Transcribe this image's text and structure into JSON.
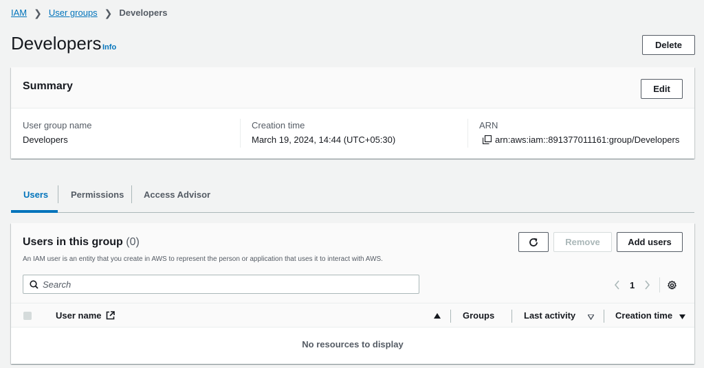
{
  "breadcrumb": {
    "root": "IAM",
    "parent": "User groups",
    "current": "Developers"
  },
  "header": {
    "title": "Developers",
    "info": "Info",
    "delete_label": "Delete"
  },
  "summary": {
    "title": "Summary",
    "edit_label": "Edit",
    "fields": [
      {
        "label": "User group name",
        "value": "Developers"
      },
      {
        "label": "Creation time",
        "value": "March 19, 2024, 14:44 (UTC+05:30)"
      },
      {
        "label": "ARN",
        "value": "arn:aws:iam::891377011161:group/Developers"
      }
    ]
  },
  "tabs": [
    {
      "label": "Users",
      "active": true
    },
    {
      "label": "Permissions",
      "active": false
    },
    {
      "label": "Access Advisor",
      "active": false
    }
  ],
  "users_panel": {
    "title": "Users in this group",
    "count": "(0)",
    "description": "An IAM user is an entity that you create in AWS to represent the person or application that uses it to interact with AWS.",
    "remove_label": "Remove",
    "add_label": "Add users",
    "search_placeholder": "Search",
    "page": "1",
    "columns": [
      "User name",
      "Groups",
      "Last activity",
      "Creation time"
    ],
    "empty_message": "No resources to display"
  },
  "colors": {
    "link": "#0073bb",
    "text": "#16191f",
    "muted": "#545b64",
    "background": "#f2f3f3"
  }
}
